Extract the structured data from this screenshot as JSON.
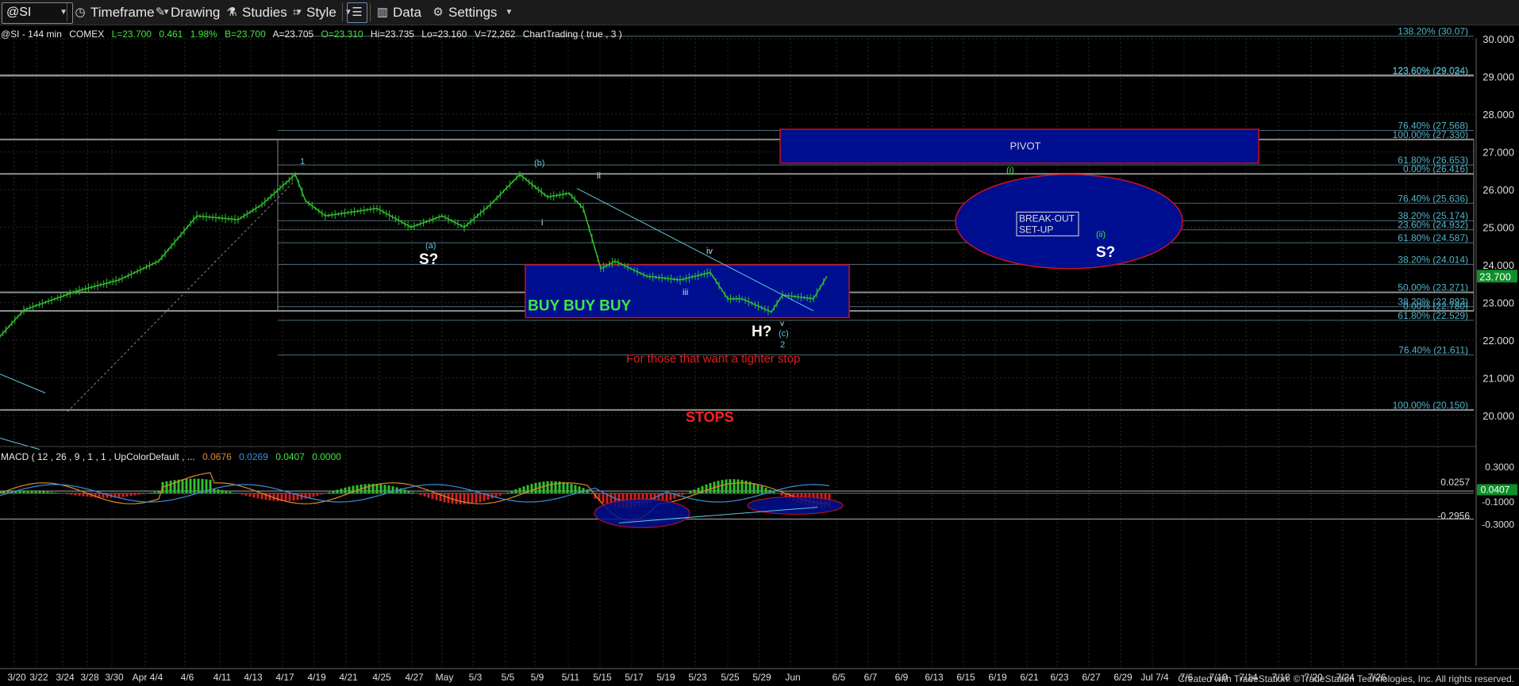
{
  "toolbar": {
    "symbol": "@SI",
    "timeframe_label": "Timeframe",
    "drawing_label": "Drawing",
    "studies_label": "Studies",
    "style_label": "Style",
    "data_label": "Data",
    "settings_label": "Settings"
  },
  "header": {
    "symbol_info": "@SI - 144 min",
    "exchange": "COMEX",
    "last": "L=23.700",
    "change": "0.461",
    "change_pct": "1.98%",
    "bid": "B=23.700",
    "ask": "A=23.705",
    "open": "O=23.310",
    "high": "Hi=23.735",
    "low": "Lo=23.160",
    "volume": "V=72,262",
    "study": "ChartTrading ( true , 3 )"
  },
  "chart_data": {
    "type": "line",
    "title": "@SI - 144 min COMEX",
    "ylim": [
      19.3,
      30.3
    ],
    "y_ticks": [
      "30.000",
      "29.000",
      "28.000",
      "27.000",
      "26.000",
      "25.000",
      "24.000",
      "23.000",
      "22.000",
      "21.000",
      "20.000"
    ],
    "x_ticks": [
      "3/20",
      "3/22",
      "3/24",
      "3/28",
      "3/30",
      "Apr 4/4",
      "4/6",
      "4/11",
      "4/13",
      "4/17",
      "4/19",
      "4/21",
      "4/25",
      "4/27",
      "May",
      "5/3",
      "5/5",
      "5/9",
      "5/11",
      "5/15",
      "5/17",
      "5/19",
      "5/23",
      "5/25",
      "5/29",
      "Jun",
      "6/5",
      "6/7",
      "6/9",
      "6/13",
      "6/15",
      "6/19",
      "6/21",
      "6/23",
      "6/27",
      "6/29",
      "Jul 7/4",
      "7/6",
      "7/10",
      "7/14",
      "7/18",
      "7/20",
      "7/24",
      "7/26"
    ],
    "price_path": {
      "x": [
        "3/17",
        "3/21",
        "3/24",
        "3/29",
        "4/1",
        "4/5",
        "4/8",
        "4/12",
        "4/14",
        "4/15",
        "4/18",
        "4/21",
        "4/25",
        "4/27",
        "4/29",
        "5/2",
        "5/4",
        "5/6",
        "5/9",
        "5/10",
        "5/11",
        "5/13",
        "5/16",
        "5/18",
        "5/20",
        "5/23",
        "5/24",
        "5/26",
        "5/27",
        "5/30",
        "5/31"
      ],
      "y": [
        22.1,
        22.8,
        23.3,
        23.6,
        24.1,
        25.3,
        25.2,
        25.6,
        26.4,
        25.7,
        25.3,
        25.5,
        25.0,
        25.3,
        25.0,
        25.6,
        26.4,
        25.8,
        25.9,
        25.5,
        23.9,
        24.1,
        23.7,
        23.6,
        23.8,
        23.1,
        23.1,
        22.75,
        23.2,
        23.1,
        23.7
      ]
    },
    "last_price": "23.700",
    "fib_levels": [
      {
        "label": "138.20% (30.07)",
        "y": 30.07
      },
      {
        "label": "123.60% (29.034)",
        "y": 29.034
      },
      {
        "label": "123.60% (29.024)",
        "y": 29.024
      },
      {
        "label": "76.40% (27.568)",
        "y": 27.568
      },
      {
        "label": "100.00% (27.330)",
        "y": 27.33
      },
      {
        "label": "61.80% (26.653)",
        "y": 26.653
      },
      {
        "label": "0.00% (26.416)",
        "y": 26.416
      },
      {
        "label": "76.40% (25.636)",
        "y": 25.636
      },
      {
        "label": "38.20% (25.174)",
        "y": 25.174
      },
      {
        "label": "23.60% (24.932)",
        "y": 24.932
      },
      {
        "label": "61.80% (24.587)",
        "y": 24.587
      },
      {
        "label": "38.20% (24.014)",
        "y": 24.014
      },
      {
        "label": "50.00% (23.271)",
        "y": 23.271
      },
      {
        "label": "38.20% (22.893)",
        "y": 22.893
      },
      {
        "label": "0.00% (22.780)",
        "y": 22.78
      },
      {
        "label": "61.80% (22.529)",
        "y": 22.529
      },
      {
        "label": "76.40% (21.611)",
        "y": 21.611
      },
      {
        "label": "100.00% (20.150)",
        "y": 20.15
      }
    ],
    "zones": [
      {
        "label": "PIVOT",
        "y_low": 26.7,
        "y_high": 27.6
      },
      {
        "label": "BUY BUY BUY",
        "y_low": 22.6,
        "y_high": 24.0
      },
      {
        "label": "BREAK-OUT SET-UP",
        "y_low": 23.9,
        "y_high": 26.4,
        "shape": "ellipse"
      }
    ],
    "annotations": {
      "wave_1": "1",
      "wave_b": "(b)",
      "wave_ii_top": "ii",
      "wave_i": "i",
      "wave_a": "(a)",
      "s_left": "S?",
      "wave_iv": "iv",
      "wave_iii": "iii",
      "wave_v": "v",
      "wave_c": "(c)",
      "wave_2": "2",
      "h_label": "H?",
      "wave_i_circ": "(i)",
      "wave_ii_circ": "(ii)",
      "s_right": "S?",
      "tighter_stop": "For those that want a tighter stop",
      "stops": "STOPS",
      "breakout_1": "BREAK-OUT",
      "breakout_2": "SET-UP"
    },
    "colors": {
      "candles": "#2fbf2f",
      "fib": "#4fb3c7",
      "zone_fill": "#000f8f",
      "zone_border": "#cc1122",
      "stops_text": "#ff2020",
      "macd_line": "#e08a2a",
      "signal_line": "#3a8fe0"
    },
    "macd": {
      "label": "MACD ( 12 , 26 , 9 , 1 , 1 , UpColorDefault , ... 0.0676 0.0269 0.0407 0.0000",
      "values": {
        "macd": "0.0676",
        "signal": "0.0269",
        "diff": "0.0407",
        "zero": "0.0000"
      },
      "y_ticks": [
        "0.3000",
        "0.0257",
        "-0.1000",
        "-0.2956",
        "-0.3000"
      ],
      "last_value": "0.0407"
    }
  },
  "footer": "Created with TradeStation. ©TradeStation Technologies, Inc. All rights reserved."
}
